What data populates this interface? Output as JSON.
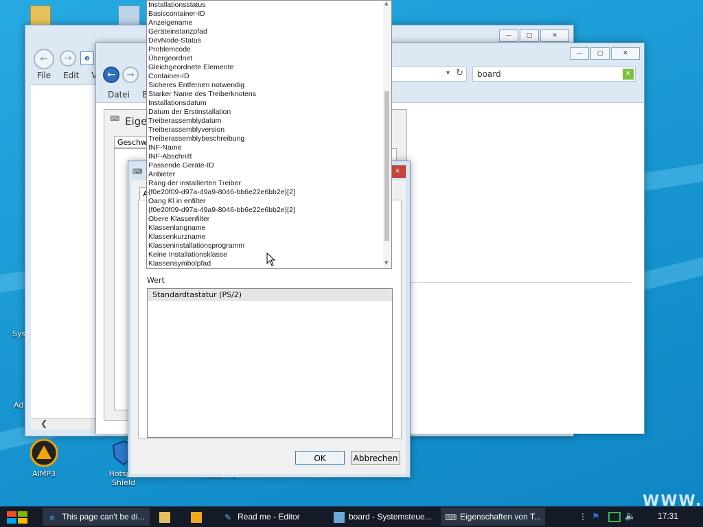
{
  "desktop": {
    "icons": [
      {
        "label": "AIMP3"
      },
      {
        "label": "Hotspot Shield"
      },
      {
        "label": "Read me"
      }
    ],
    "partial_labels": [
      "Sys",
      "Ad"
    ]
  },
  "back_window": {
    "menu": [
      "File",
      "Edit",
      "Vie"
    ]
  },
  "mid_window": {
    "menu": [
      "Datei",
      "Be"
    ],
    "search_value": "board",
    "dialog_title": "Eigen",
    "tab_label": "Geschwi",
    "group_label": "Ge"
  },
  "front_dialog": {
    "tab_fragment": "A",
    "value_label": "Wert",
    "value_row": "Standardtastatur (PS/2)",
    "ok": "OK",
    "cancel": "Abbrechen"
  },
  "dropdown": {
    "items": [
      "Installationsstatus",
      "Basiscontainer-ID",
      "Anzeigename",
      "Geräteinstanzpfad",
      "DevNode-Status",
      "Problemcode",
      "Übergeordnet",
      "Gleichgeordnete Elemente",
      "Container-ID",
      "Sicheres Entfernen notwendig",
      "Starker Name des Treiberknotens",
      "Installationsdatum",
      "Datum der Erstinstallation",
      "Treiberassemblydatum",
      "Treiberassemblyversion",
      "Treiberassemblybeschreibung",
      "INF-Name",
      "INF-Abschnitt",
      "Passende Geräte-ID",
      "Anbieter",
      "Rang der installierten Treiber",
      "{f0e20f09-d97a-49a9-8046-bb6e22e6bb2e}[2]",
      "Oang  Kl  in   enfilter",
      "{f0e20f09-d97a-49a9-8046-bb6e22e6bb2e}[2]",
      "Obere Klassenfilter",
      "Klassenlangname",
      "Klassenkurzname",
      "Klasseninstallationsprogramm",
      "Keine Installationsklasse",
      "Klassensymbolpfad"
    ]
  },
  "taskbar": {
    "items": [
      {
        "label": "This page can't be di..."
      },
      {
        "label": "Read me - Editor"
      },
      {
        "label": "board - Systemsteue..."
      },
      {
        "label": "Eigenschaften von T..."
      }
    ],
    "clock": "17:31"
  },
  "watermark": "WWW.FR"
}
